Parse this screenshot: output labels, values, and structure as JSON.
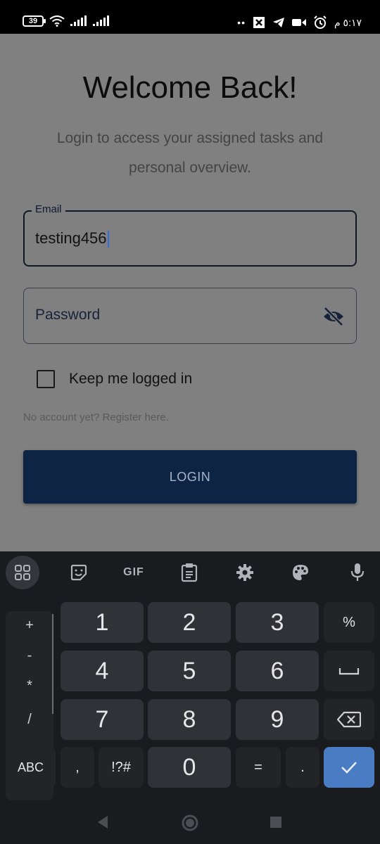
{
  "status_bar": {
    "battery": "39",
    "time": "٥:١٧ م"
  },
  "login": {
    "title": "Welcome Back!",
    "subtitle": "Login to access your assigned tasks and personal overview.",
    "email_label": "Email",
    "email_value": "testing456",
    "password_placeholder": "Password",
    "keep_logged_in_label": "Keep me logged in",
    "keep_logged_in_checked": false,
    "register_link": "No account yet? Register here.",
    "login_button": "LOGIN"
  },
  "keyboard": {
    "toolbar": {
      "gif_label": "GIF"
    },
    "symbols": [
      "+",
      "-",
      "*",
      "/"
    ],
    "keys": {
      "k1": "1",
      "k2": "2",
      "k3": "3",
      "percent": "%",
      "k4": "4",
      "k5": "5",
      "k6": "6",
      "k7": "7",
      "k8": "8",
      "k9": "9",
      "abc": "ABC",
      "comma": ",",
      "symbols": "!?#",
      "k0": "0",
      "equals": "=",
      "period": "."
    }
  },
  "colors": {
    "app_background": "#808080",
    "login_button": "#0e2444",
    "keyboard_background": "#191b1e",
    "key_background": "#303237",
    "enter_key": "#4a7cc4",
    "caret": "#2d6fe0"
  }
}
